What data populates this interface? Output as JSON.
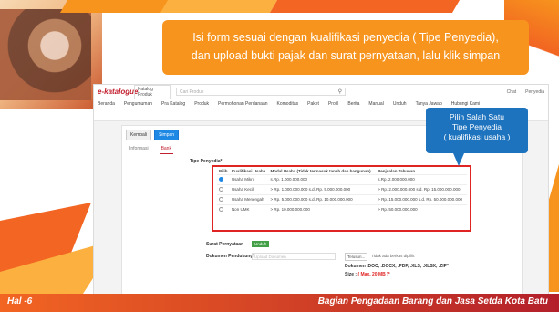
{
  "slide": {
    "callout_top": [
      "Isi form sesuai dengan kualifikasi penyedia ( Tipe Penyedia),",
      "dan upload bukti pajak dan surat pernyataan, lalu klik simpan"
    ],
    "callout_right": [
      "Pilih Salah Satu",
      "Tipe Penyedia",
      "( kualifikasi usaha )"
    ],
    "footer_page": "Hal -6",
    "footer_org": "Bagian Pengadaan Barang dan Jasa Setda Kota Batu"
  },
  "app": {
    "logo": "e-katalogue",
    "catalog_select": "Katalog Produk",
    "search_placeholder": "Cari Produk",
    "top_right": [
      "Chat",
      "Penyedia"
    ],
    "nav": [
      "Beranda",
      "Pengumuman",
      "Pra Katalog",
      "Produk",
      "Permohonan Perdanaan",
      "Komoditas",
      "Paket",
      "Profil",
      "Berita",
      "Manual",
      "Unduh",
      "Tanya Jawab",
      "Hubungi Kami"
    ],
    "back_button": "Kembali",
    "save_button": "Simpan",
    "tabs": [
      "Informasi",
      "Bank"
    ],
    "field_tipe_label": "Tipe Penyedia*",
    "date_hint": "",
    "table_headers": [
      "Pilih",
      "Kualifikasi Usaha",
      "Modal Usaha (Tidak termasuk tanah dan bangunan)",
      "Penjualan Tahunan"
    ],
    "table_rows": [
      {
        "selected": true,
        "kualifikasi": "Usaha Mikro",
        "modal": "s.Rp. 1.000.000.000",
        "penjualan": "s.Rp. 2.000.000.000"
      },
      {
        "selected": false,
        "kualifikasi": "Usaha Kecil",
        "modal": "> Rp. 1.000.000.000 s.d. Rp. 5.000.000.000",
        "penjualan": "> Rp. 2.000.000.000 s.d. Rp. 15.000.000.000"
      },
      {
        "selected": false,
        "kualifikasi": "Usaha Menengah",
        "modal": "> Rp. 5.000.000.000 s.d. Rp. 10.000.000.000",
        "penjualan": "> Rp. 15.000.000.000 s.d. Rp. 50.000.000.000"
      },
      {
        "selected": false,
        "kualifikasi": "Non UMK",
        "modal": "> Rp. 10.000.000.000",
        "penjualan": "> Rp. 50.000.000.000"
      }
    ],
    "surat_label": "Surat Pernyataan",
    "upload_button": "Unduh",
    "dok_label": "Dokumen Pendukung*",
    "dok_placeholder": "Upload Dokumen",
    "dok_hint": "",
    "file_button": "Telusuri...",
    "file_none": "Tidak ada berkas dipilih.",
    "doc_note": "Dokumen .DOC, .DOCX, .PDF, .XLS, .XLSX, .ZIP*",
    "size_note_prefix": "Size : ",
    "size_note_value": "( Max. 20 MB )*"
  },
  "colors": {
    "accent_orange": "#f7941d",
    "callout_blue": "#1e73be",
    "highlight_red": "#e02424",
    "save_blue": "#1e88e5"
  }
}
